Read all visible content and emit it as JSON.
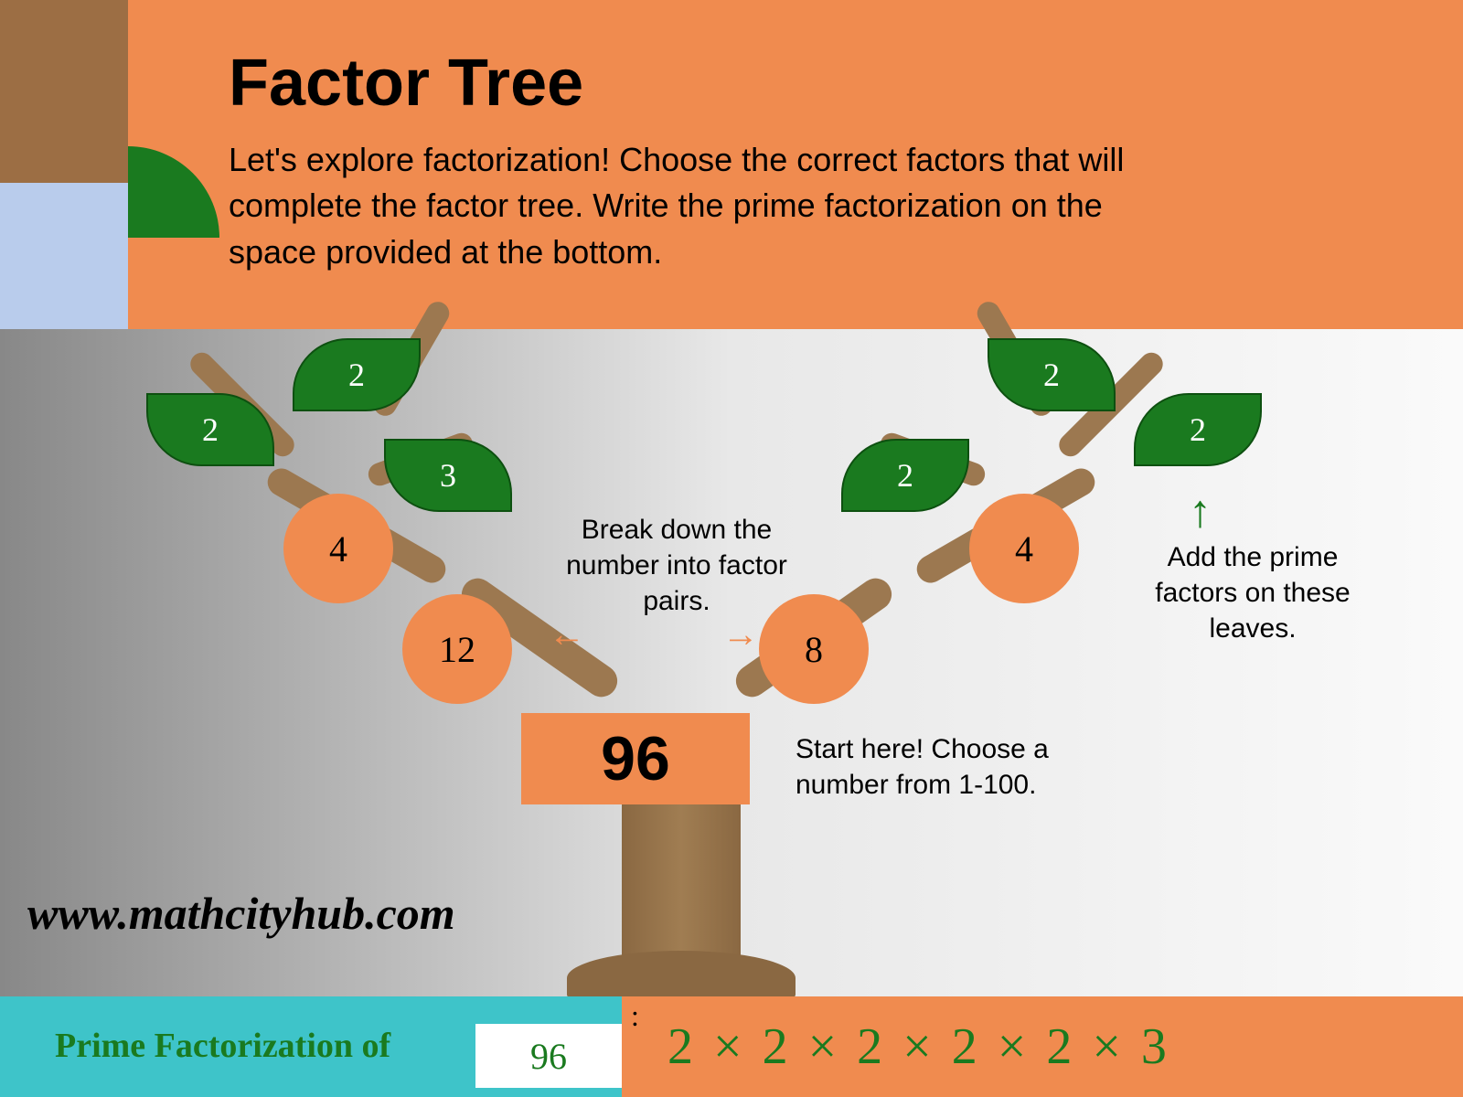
{
  "title": "Factor Tree",
  "subtitle": "Let's explore factorization! Choose the correct factors that will complete the factor tree. Write the prime factorization on the space provided at the bottom.",
  "root_number": "96",
  "tree": {
    "left_branch": {
      "node": "12",
      "child_node": "4",
      "leaves": [
        "2",
        "2",
        "3"
      ]
    },
    "right_branch": {
      "node": "8",
      "child_node": "4",
      "leaves": [
        "2",
        "2",
        "2"
      ]
    }
  },
  "hints": {
    "center": "Break down the number into factor pairs.",
    "right": "Add the prime factors on these leaves.",
    "start": "Start here! Choose a number from 1-100."
  },
  "arrows": {
    "left": "←",
    "right": "→",
    "up": "↑"
  },
  "watermark": "www.mathcityhub.com",
  "footer": {
    "label": "Prime Factorization of",
    "number": "96",
    "result": "2 × 2 × 2 × 2 × 2 × 3",
    "colon": ":"
  },
  "colors": {
    "orange": "#f08b4f",
    "green": "#1a7a1f",
    "brown": "#9c6e44",
    "blue": "#b9ccec",
    "teal": "#3ec4c9",
    "trunk": "#9c7850"
  }
}
